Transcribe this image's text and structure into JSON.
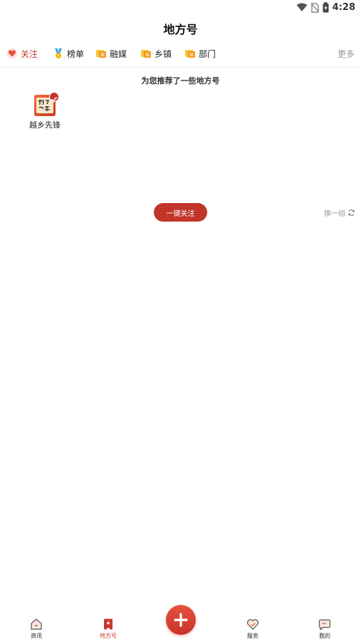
{
  "status_bar": {
    "time": "4:28"
  },
  "header": {
    "title": "地方号"
  },
  "tabs": [
    {
      "label": "关注",
      "icon": "heart-icon",
      "active": true
    },
    {
      "label": "榜单",
      "icon": "medal-icon",
      "active": false
    },
    {
      "label": "融媒",
      "icon": "folder-icon",
      "active": false
    },
    {
      "label": "乡镇",
      "icon": "folder-icon",
      "active": false
    },
    {
      "label": "部门",
      "icon": "folder-icon",
      "active": false
    }
  ],
  "more_label": "更多",
  "recommend": {
    "subtitle": "为您推荐了一些地方号",
    "items": [
      {
        "name": "越乡先锋",
        "logo_text": "越乡 先锋",
        "selected": true
      }
    ],
    "follow_all_label": "一键关注",
    "refresh_label": "换一组"
  },
  "bottom_nav": [
    {
      "label": "资讯",
      "icon": "home-icon",
      "active": false
    },
    {
      "label": "地方号",
      "icon": "bookmark-icon",
      "active": true
    },
    {
      "label": "",
      "icon": "plus-icon",
      "active": false
    },
    {
      "label": "服务",
      "icon": "heart-check-icon",
      "active": false
    },
    {
      "label": "我的",
      "icon": "chat-face-icon",
      "active": false
    }
  ],
  "colors": {
    "accent": "#c8372d",
    "muted": "#999999"
  }
}
